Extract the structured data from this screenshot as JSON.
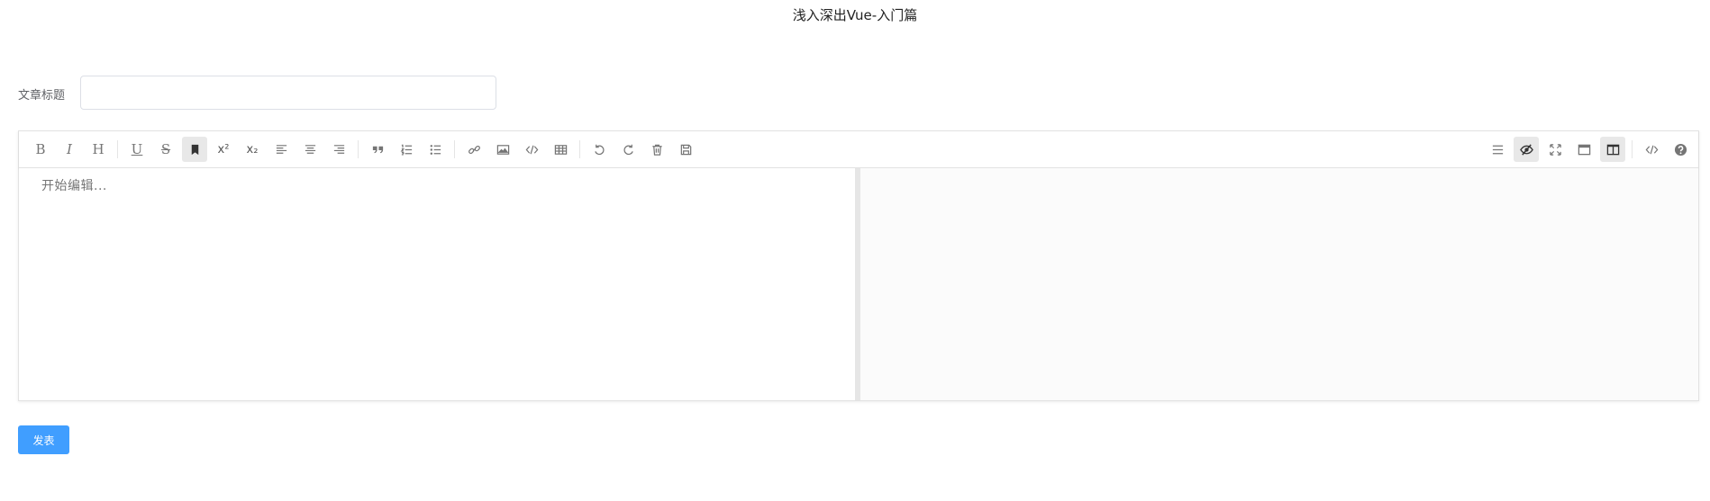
{
  "header": {
    "title": "浅入深出Vue-入门篇"
  },
  "form": {
    "title_label": "文章标题",
    "title_value": "",
    "title_placeholder": ""
  },
  "toolbar": {
    "left": [
      {
        "name": "bold-button",
        "icon": "bold-icon",
        "glyph": "B",
        "active": false
      },
      {
        "name": "italic-button",
        "icon": "italic-icon",
        "glyph": "I",
        "active": false
      },
      {
        "name": "header-button",
        "icon": "header-icon",
        "glyph": "H",
        "active": false
      },
      {
        "sep": true
      },
      {
        "name": "underline-button",
        "icon": "underline-icon",
        "glyph": "U",
        "active": false
      },
      {
        "name": "strikethrough-button",
        "icon": "strikethrough-icon",
        "glyph": "S",
        "active": false
      },
      {
        "name": "mark-button",
        "icon": "bookmark-icon",
        "active": true
      },
      {
        "name": "superscript-button",
        "icon": "superscript-icon",
        "glyph": "x²",
        "active": false
      },
      {
        "name": "subscript-button",
        "icon": "subscript-icon",
        "glyph": "x₂",
        "active": false
      },
      {
        "name": "align-left-button",
        "icon": "align-left-icon",
        "active": false
      },
      {
        "name": "align-center-button",
        "icon": "align-center-icon",
        "active": false
      },
      {
        "name": "align-right-button",
        "icon": "align-right-icon",
        "active": false
      },
      {
        "sep": true
      },
      {
        "name": "quote-button",
        "icon": "quote-icon",
        "active": false
      },
      {
        "name": "ordered-list-button",
        "icon": "ordered-list-icon",
        "active": false
      },
      {
        "name": "unordered-list-button",
        "icon": "unordered-list-icon",
        "active": false
      },
      {
        "sep": true
      },
      {
        "name": "link-button",
        "icon": "link-icon",
        "active": false
      },
      {
        "name": "image-button",
        "icon": "image-icon",
        "active": false
      },
      {
        "name": "code-button",
        "icon": "code-icon",
        "active": false
      },
      {
        "name": "table-button",
        "icon": "table-icon",
        "active": false
      },
      {
        "sep": true
      },
      {
        "name": "undo-button",
        "icon": "undo-icon",
        "active": false
      },
      {
        "name": "redo-button",
        "icon": "redo-icon",
        "active": false
      },
      {
        "name": "trash-button",
        "icon": "trash-icon",
        "active": false
      },
      {
        "name": "save-button",
        "icon": "save-icon",
        "active": false
      }
    ],
    "right": [
      {
        "name": "navigation-button",
        "icon": "menu-icon",
        "active": false
      },
      {
        "name": "toggle-preview-button",
        "icon": "eye-slash-icon",
        "active": true
      },
      {
        "name": "fullscreen-button",
        "icon": "expand-icon",
        "active": false
      },
      {
        "name": "read-mode-button",
        "icon": "window-icon",
        "active": false
      },
      {
        "name": "subfield-button",
        "icon": "columns-icon",
        "active": true
      },
      {
        "sep": true
      },
      {
        "name": "html-code-button",
        "icon": "code-icon",
        "active": false
      },
      {
        "name": "help-button",
        "icon": "question-circle-icon",
        "active": false
      }
    ]
  },
  "editor": {
    "placeholder": "开始编辑..."
  },
  "actions": {
    "publish_label": "发表"
  },
  "colors": {
    "primary": "#409eff",
    "toolbar_icon": "#757575",
    "active_bg": "#e8e8e8",
    "preview_bg": "#fbfbfb"
  }
}
